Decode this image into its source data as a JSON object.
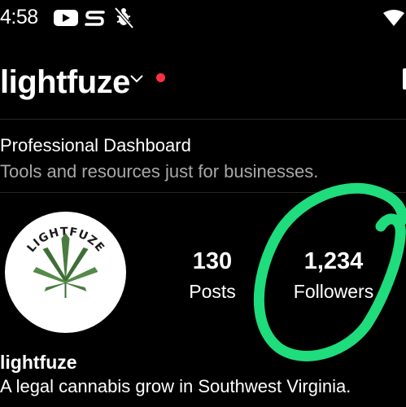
{
  "status_bar": {
    "time": "4:58",
    "icons": [
      "youtube-icon",
      "stash-s-icon",
      "bug-off-icon"
    ],
    "wifi": "wifi-icon"
  },
  "header": {
    "username": "lightfuze",
    "switch_icon": "chevron-down-icon",
    "notification_dot_color": "#ff3040"
  },
  "dashboard": {
    "title": "Professional Dashboard",
    "subtitle": "Tools and resources just for businesses."
  },
  "profile": {
    "avatar_text": "LIGHTFUZE",
    "stats": [
      {
        "value": "130",
        "label": "Posts"
      },
      {
        "value": "1,234",
        "label": "Followers"
      }
    ],
    "display_name": "lightfuze",
    "bio": "A legal cannabis grow in Southwest Virginia."
  },
  "annotation": {
    "color": "#1fdc7c"
  },
  "colors": {
    "background": "#000000",
    "text": "#ffffff",
    "muted": "#a8a8a8",
    "divider": "#262626"
  }
}
